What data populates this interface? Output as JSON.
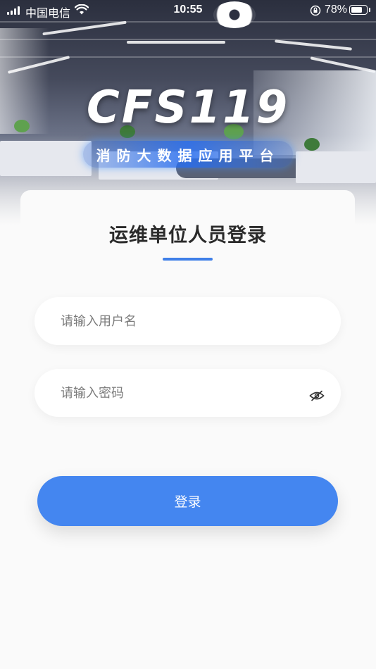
{
  "status_bar": {
    "carrier": "中国电信",
    "time": "10:55",
    "battery": "78%",
    "battery_level": 0.78
  },
  "brand": {
    "title": "CFS119",
    "subtitle": "消防大数据应用平台"
  },
  "login": {
    "title": "运维单位人员登录",
    "username_placeholder": "请输入用户名",
    "password_placeholder": "请输入密码",
    "submit_label": "登录"
  },
  "colors": {
    "accent": "#4486f0",
    "title_text": "#2a2a2a",
    "placeholder_text": "#7c7c7c",
    "background": "#fafafa"
  },
  "icons": {
    "password_toggle": "eye-hidden-icon",
    "wifi": "wifi-icon",
    "orientation_lock": "orientation-lock-icon"
  }
}
